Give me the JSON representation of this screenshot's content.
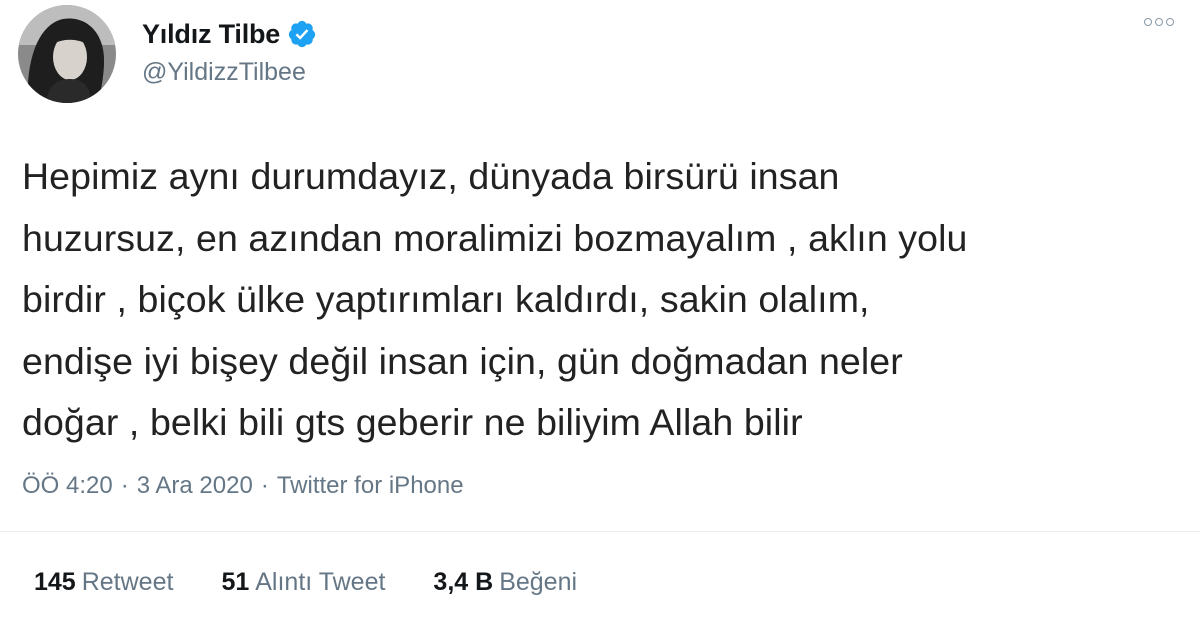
{
  "author": {
    "display_name": "Yıldız Tilbe",
    "handle": "@YildizzTilbee",
    "verified": true,
    "verified_color": "#1da1f2"
  },
  "tweet": {
    "lines": [
      "Hepimiz aynı durumdayız, dünyada birsürü insan",
      "huzursuz, en azından moralimizi bozmayalım , aklın yolu",
      "birdir , biçok ülke yaptırımları kaldırdı, sakin olalım,",
      "endişe iyi bişey değil insan için, gün doğmadan neler",
      "doğar , belki bili gts geberir ne biliyim Allah bilir"
    ]
  },
  "meta": {
    "time": "ÖÖ 4:20",
    "date": "3 Ara 2020",
    "source": "Twitter for iPhone",
    "separator": "·"
  },
  "stats": {
    "retweets": {
      "count": "145",
      "label": "Retweet"
    },
    "quotes": {
      "count": "51",
      "label": "Alıntı Tweet"
    },
    "likes": {
      "count": "3,4 B",
      "label": "Beğeni"
    }
  },
  "icons": {
    "more": "more-options-icon",
    "verified": "verified-badge-icon"
  }
}
